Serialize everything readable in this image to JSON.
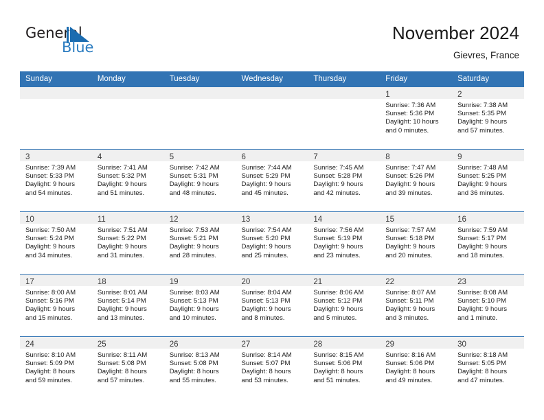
{
  "brand": {
    "name_part1": "General",
    "name_part2": "Blue",
    "mark_color": "#1b6cb0"
  },
  "header": {
    "title": "November 2024",
    "subtitle": "Gievres, France",
    "accent_color": "#3274b4",
    "band_color": "#f0f0f0"
  },
  "calendar": {
    "weekday_headers": [
      "Sunday",
      "Monday",
      "Tuesday",
      "Wednesday",
      "Thursday",
      "Friday",
      "Saturday"
    ],
    "weeks": [
      [
        {
          "date": "",
          "sunrise": "",
          "sunset": "",
          "daylight_line1": "",
          "daylight_line2": ""
        },
        {
          "date": "",
          "sunrise": "",
          "sunset": "",
          "daylight_line1": "",
          "daylight_line2": ""
        },
        {
          "date": "",
          "sunrise": "",
          "sunset": "",
          "daylight_line1": "",
          "daylight_line2": ""
        },
        {
          "date": "",
          "sunrise": "",
          "sunset": "",
          "daylight_line1": "",
          "daylight_line2": ""
        },
        {
          "date": "",
          "sunrise": "",
          "sunset": "",
          "daylight_line1": "",
          "daylight_line2": ""
        },
        {
          "date": "1",
          "sunrise": "Sunrise: 7:36 AM",
          "sunset": "Sunset: 5:36 PM",
          "daylight_line1": "Daylight: 10 hours",
          "daylight_line2": "and 0 minutes."
        },
        {
          "date": "2",
          "sunrise": "Sunrise: 7:38 AM",
          "sunset": "Sunset: 5:35 PM",
          "daylight_line1": "Daylight: 9 hours",
          "daylight_line2": "and 57 minutes."
        }
      ],
      [
        {
          "date": "3",
          "sunrise": "Sunrise: 7:39 AM",
          "sunset": "Sunset: 5:33 PM",
          "daylight_line1": "Daylight: 9 hours",
          "daylight_line2": "and 54 minutes."
        },
        {
          "date": "4",
          "sunrise": "Sunrise: 7:41 AM",
          "sunset": "Sunset: 5:32 PM",
          "daylight_line1": "Daylight: 9 hours",
          "daylight_line2": "and 51 minutes."
        },
        {
          "date": "5",
          "sunrise": "Sunrise: 7:42 AM",
          "sunset": "Sunset: 5:31 PM",
          "daylight_line1": "Daylight: 9 hours",
          "daylight_line2": "and 48 minutes."
        },
        {
          "date": "6",
          "sunrise": "Sunrise: 7:44 AM",
          "sunset": "Sunset: 5:29 PM",
          "daylight_line1": "Daylight: 9 hours",
          "daylight_line2": "and 45 minutes."
        },
        {
          "date": "7",
          "sunrise": "Sunrise: 7:45 AM",
          "sunset": "Sunset: 5:28 PM",
          "daylight_line1": "Daylight: 9 hours",
          "daylight_line2": "and 42 minutes."
        },
        {
          "date": "8",
          "sunrise": "Sunrise: 7:47 AM",
          "sunset": "Sunset: 5:26 PM",
          "daylight_line1": "Daylight: 9 hours",
          "daylight_line2": "and 39 minutes."
        },
        {
          "date": "9",
          "sunrise": "Sunrise: 7:48 AM",
          "sunset": "Sunset: 5:25 PM",
          "daylight_line1": "Daylight: 9 hours",
          "daylight_line2": "and 36 minutes."
        }
      ],
      [
        {
          "date": "10",
          "sunrise": "Sunrise: 7:50 AM",
          "sunset": "Sunset: 5:24 PM",
          "daylight_line1": "Daylight: 9 hours",
          "daylight_line2": "and 34 minutes."
        },
        {
          "date": "11",
          "sunrise": "Sunrise: 7:51 AM",
          "sunset": "Sunset: 5:22 PM",
          "daylight_line1": "Daylight: 9 hours",
          "daylight_line2": "and 31 minutes."
        },
        {
          "date": "12",
          "sunrise": "Sunrise: 7:53 AM",
          "sunset": "Sunset: 5:21 PM",
          "daylight_line1": "Daylight: 9 hours",
          "daylight_line2": "and 28 minutes."
        },
        {
          "date": "13",
          "sunrise": "Sunrise: 7:54 AM",
          "sunset": "Sunset: 5:20 PM",
          "daylight_line1": "Daylight: 9 hours",
          "daylight_line2": "and 25 minutes."
        },
        {
          "date": "14",
          "sunrise": "Sunrise: 7:56 AM",
          "sunset": "Sunset: 5:19 PM",
          "daylight_line1": "Daylight: 9 hours",
          "daylight_line2": "and 23 minutes."
        },
        {
          "date": "15",
          "sunrise": "Sunrise: 7:57 AM",
          "sunset": "Sunset: 5:18 PM",
          "daylight_line1": "Daylight: 9 hours",
          "daylight_line2": "and 20 minutes."
        },
        {
          "date": "16",
          "sunrise": "Sunrise: 7:59 AM",
          "sunset": "Sunset: 5:17 PM",
          "daylight_line1": "Daylight: 9 hours",
          "daylight_line2": "and 18 minutes."
        }
      ],
      [
        {
          "date": "17",
          "sunrise": "Sunrise: 8:00 AM",
          "sunset": "Sunset: 5:16 PM",
          "daylight_line1": "Daylight: 9 hours",
          "daylight_line2": "and 15 minutes."
        },
        {
          "date": "18",
          "sunrise": "Sunrise: 8:01 AM",
          "sunset": "Sunset: 5:14 PM",
          "daylight_line1": "Daylight: 9 hours",
          "daylight_line2": "and 13 minutes."
        },
        {
          "date": "19",
          "sunrise": "Sunrise: 8:03 AM",
          "sunset": "Sunset: 5:13 PM",
          "daylight_line1": "Daylight: 9 hours",
          "daylight_line2": "and 10 minutes."
        },
        {
          "date": "20",
          "sunrise": "Sunrise: 8:04 AM",
          "sunset": "Sunset: 5:13 PM",
          "daylight_line1": "Daylight: 9 hours",
          "daylight_line2": "and 8 minutes."
        },
        {
          "date": "21",
          "sunrise": "Sunrise: 8:06 AM",
          "sunset": "Sunset: 5:12 PM",
          "daylight_line1": "Daylight: 9 hours",
          "daylight_line2": "and 5 minutes."
        },
        {
          "date": "22",
          "sunrise": "Sunrise: 8:07 AM",
          "sunset": "Sunset: 5:11 PM",
          "daylight_line1": "Daylight: 9 hours",
          "daylight_line2": "and 3 minutes."
        },
        {
          "date": "23",
          "sunrise": "Sunrise: 8:08 AM",
          "sunset": "Sunset: 5:10 PM",
          "daylight_line1": "Daylight: 9 hours",
          "daylight_line2": "and 1 minute."
        }
      ],
      [
        {
          "date": "24",
          "sunrise": "Sunrise: 8:10 AM",
          "sunset": "Sunset: 5:09 PM",
          "daylight_line1": "Daylight: 8 hours",
          "daylight_line2": "and 59 minutes."
        },
        {
          "date": "25",
          "sunrise": "Sunrise: 8:11 AM",
          "sunset": "Sunset: 5:08 PM",
          "daylight_line1": "Daylight: 8 hours",
          "daylight_line2": "and 57 minutes."
        },
        {
          "date": "26",
          "sunrise": "Sunrise: 8:13 AM",
          "sunset": "Sunset: 5:08 PM",
          "daylight_line1": "Daylight: 8 hours",
          "daylight_line2": "and 55 minutes."
        },
        {
          "date": "27",
          "sunrise": "Sunrise: 8:14 AM",
          "sunset": "Sunset: 5:07 PM",
          "daylight_line1": "Daylight: 8 hours",
          "daylight_line2": "and 53 minutes."
        },
        {
          "date": "28",
          "sunrise": "Sunrise: 8:15 AM",
          "sunset": "Sunset: 5:06 PM",
          "daylight_line1": "Daylight: 8 hours",
          "daylight_line2": "and 51 minutes."
        },
        {
          "date": "29",
          "sunrise": "Sunrise: 8:16 AM",
          "sunset": "Sunset: 5:06 PM",
          "daylight_line1": "Daylight: 8 hours",
          "daylight_line2": "and 49 minutes."
        },
        {
          "date": "30",
          "sunrise": "Sunrise: 8:18 AM",
          "sunset": "Sunset: 5:05 PM",
          "daylight_line1": "Daylight: 8 hours",
          "daylight_line2": "and 47 minutes."
        }
      ]
    ]
  }
}
